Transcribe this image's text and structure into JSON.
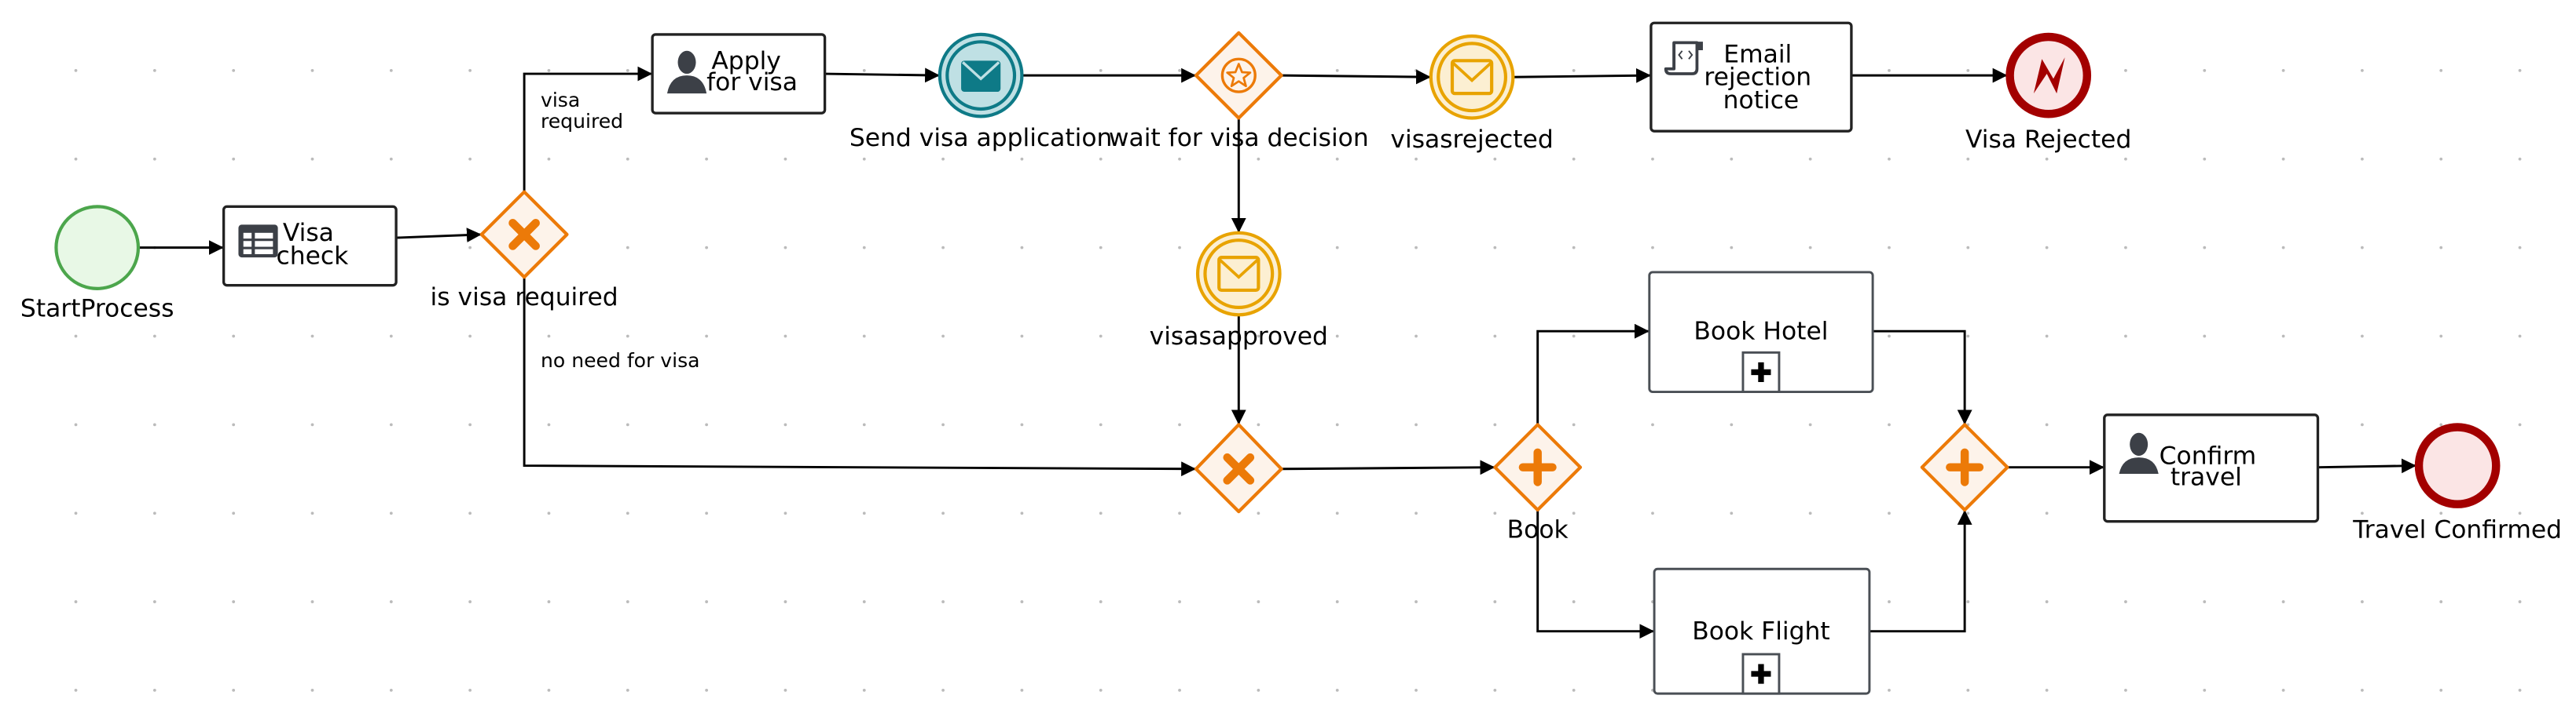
{
  "diagram": {
    "type": "BPMN process",
    "colors": {
      "start_stroke": "#4ca64c",
      "start_fill": "#e8f8e6",
      "gateway_stroke": "#ec7a08",
      "gateway_fill": "#fdf3ea",
      "throw_message_stroke": "#0e7a87",
      "throw_message_fill": "#bfe0e4",
      "catch_message_stroke": "#e8a300",
      "catch_message_fill": "#fcefd2",
      "end_stroke": "#a30000",
      "end_fill": "#fbe5e5",
      "icon_dark": "#3c4047"
    },
    "nodes": {
      "start": {
        "label": "StartProcess",
        "kind": "start-event"
      },
      "visa_check": {
        "line1": "Visa",
        "line2": "check",
        "kind": "business-rule-task",
        "icon": "table-icon"
      },
      "is_visa_required": {
        "label": "is visa required",
        "kind": "exclusive-gateway"
      },
      "apply_for_visa": {
        "line1": "Apply",
        "line2": "for visa",
        "kind": "user-task",
        "icon": "user-icon"
      },
      "send_visa_application": {
        "label": "Send visa application",
        "kind": "intermediate-throw-message-event"
      },
      "wait_for_visa_decision": {
        "label": "wait for visa decision",
        "kind": "event-based-gateway"
      },
      "visasrejected": {
        "label": "visasrejected",
        "kind": "intermediate-catch-message-event"
      },
      "email_rejection_notice": {
        "line1": "Email",
        "line2": "rejection",
        "line3": "notice",
        "kind": "script-task",
        "icon": "script-icon"
      },
      "visa_rejected": {
        "label": "Visa Rejected",
        "kind": "error-end-event"
      },
      "visasapproved": {
        "label": "visasapproved",
        "kind": "intermediate-catch-message-event"
      },
      "merge_gateway": {
        "label": "",
        "kind": "exclusive-gateway"
      },
      "book": {
        "label": "Book",
        "kind": "parallel-gateway"
      },
      "book_hotel": {
        "label": "Book Hotel",
        "kind": "collapsed-subprocess"
      },
      "book_flight": {
        "label": "Book Flight",
        "kind": "collapsed-subprocess"
      },
      "join_gateway": {
        "label": "",
        "kind": "parallel-gateway"
      },
      "confirm_travel": {
        "line1": "Confirm",
        "line2": "travel",
        "kind": "user-task",
        "icon": "user-icon"
      },
      "travel_confirmed": {
        "label": "Travel Confirmed",
        "kind": "end-event"
      }
    },
    "flow_labels": {
      "visa_required_1": "visa",
      "visa_required_2": "required",
      "no_need_for_visa": "no need for visa"
    }
  }
}
